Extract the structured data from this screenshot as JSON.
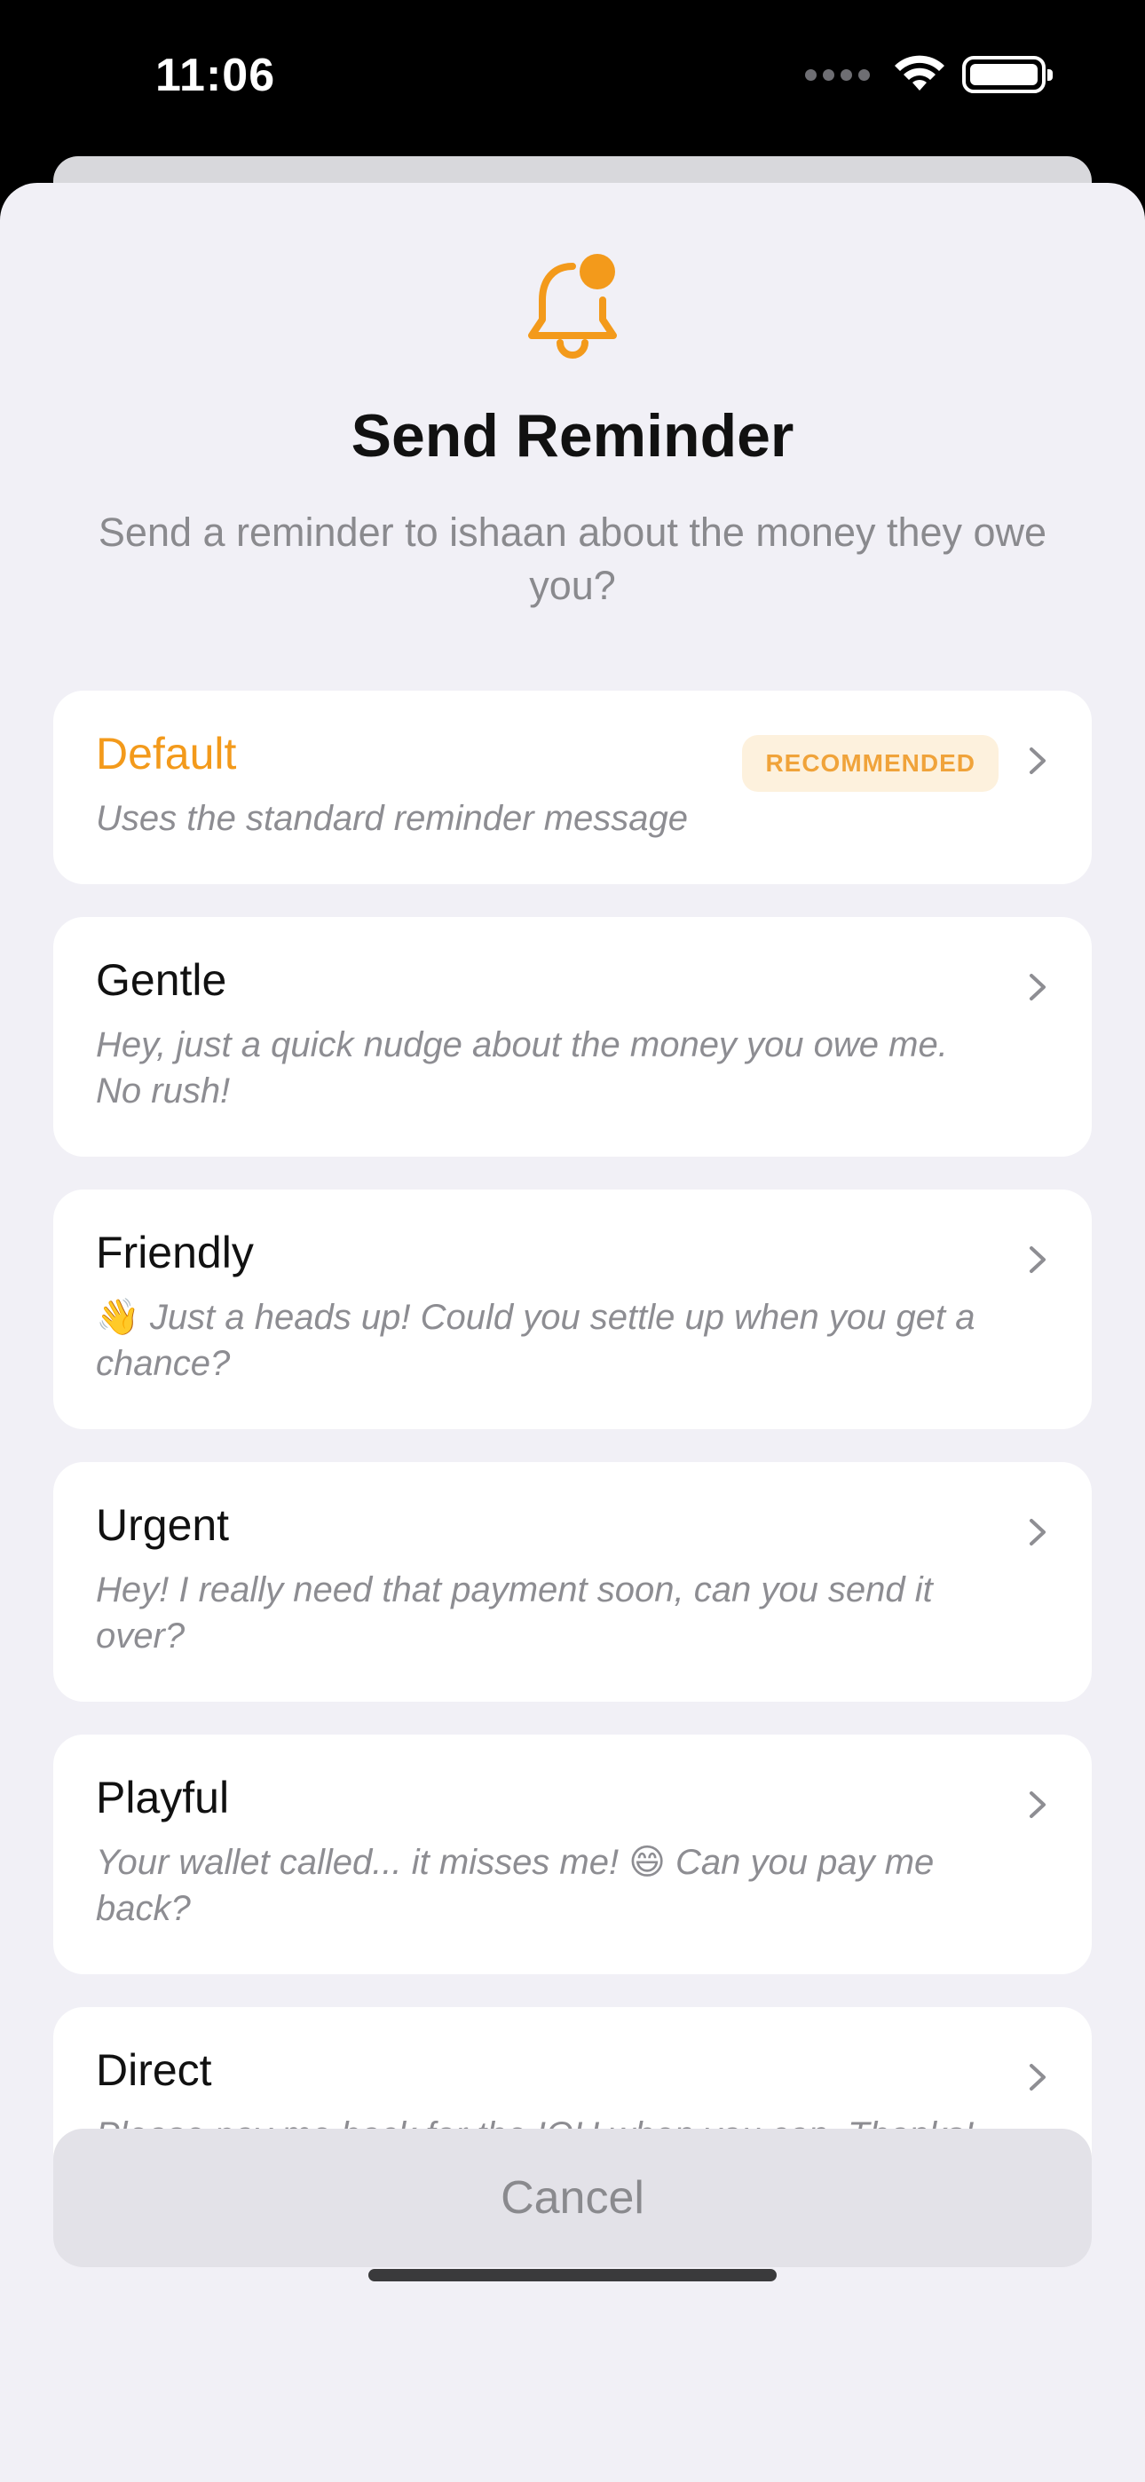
{
  "status_bar": {
    "time": "11:06"
  },
  "header": {
    "icon": "bell-notification-icon",
    "title": "Send Reminder",
    "subtitle": "Send a reminder to ishaan about the money they owe you?"
  },
  "options": [
    {
      "name": "Default",
      "badge": "RECOMMENDED",
      "desc": "Uses the standard reminder message"
    },
    {
      "name": "Gentle",
      "desc": "Hey, just a quick nudge about the money you owe me. No rush!"
    },
    {
      "name": "Friendly",
      "emoji": "👋",
      "desc": " Just a heads up! Could you settle up when you get a chance?"
    },
    {
      "name": "Urgent",
      "desc": "Hey! I really need that payment soon, can you send it over?"
    },
    {
      "name": "Playful",
      "desc_before": "Your wallet called... it misses me! ",
      "emoji": "😄",
      "desc_after": " Can you pay me back?"
    },
    {
      "name": "Direct",
      "desc": "Please pay me back for the IOU when you can. Thanks!"
    }
  ],
  "cancel_label": "Cancel",
  "colors": {
    "accent": "#f39a1b",
    "badge_bg": "#fdf1dd",
    "sheet_bg": "#f1f0f6"
  }
}
